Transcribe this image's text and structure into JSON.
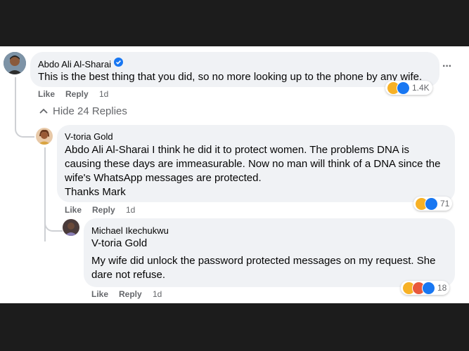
{
  "comment1": {
    "author": "Abdo Ali Al-Sharai",
    "text": "This is the best thing that you did, so no more looking up to the phone by any wife.",
    "like_label": "Like",
    "reply_label": "Reply",
    "time": "1d",
    "reaction_count": "1.4K",
    "more_icon": "···"
  },
  "replies_toggle": {
    "label": "Hide 24 Replies"
  },
  "comment2": {
    "author": "V-toria Gold",
    "tag": "Abdo Ali Al-Sharai",
    "text": "I think he did it to protect women. The problems DNA is causing these days are immeasurable. Now no man will think of a DNA since the wife's WhatsApp messages are protected.",
    "text2": "Thanks Mark",
    "like_label": "Like",
    "reply_label": "Reply",
    "time": "1d",
    "reaction_count": "71"
  },
  "comment3": {
    "author": "Michael Ikechukwu",
    "tag": "V-toria Gold",
    "text": "My wife did unlock the password protected messages on my request. She dare not refuse.",
    "like_label": "Like",
    "reply_label": "Reply",
    "time": "1d",
    "reaction_count": "18"
  },
  "colors": {
    "bubble": "#f0f2f5",
    "verified": "#1877f2",
    "like": "#1877f2",
    "haha": "#f7b125",
    "angry": "#e8593c",
    "meta": "#65676b"
  }
}
